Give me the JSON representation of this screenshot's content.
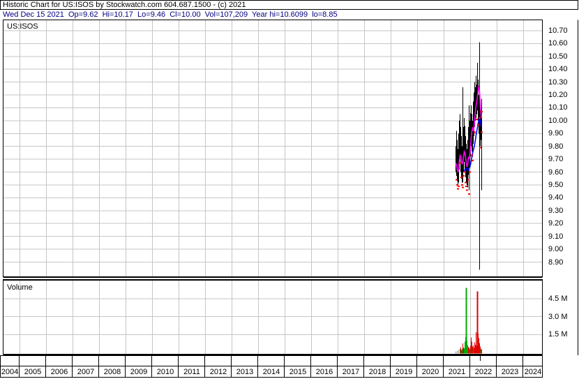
{
  "header": {
    "title": "Historic Chart for US:ISOS by Stockwatch.com 604.687.1500 - (c) 2021",
    "info_line": "Wed Dec 15 2021  Op=9.62  Hi=10.17  Lo=9.46  Cl=10.00  Vol=107,209  Year hi=10.6099  lo=8.85"
  },
  "price_panel": {
    "label": "US:ISOS"
  },
  "volume_panel": {
    "label": "Volume"
  },
  "colors": {
    "background": "#ffffff",
    "border": "#000000",
    "grid": "#c6c6c6",
    "bar": "#000000",
    "ma_fast": "#ff00ff",
    "ma_slow": "#0000ff",
    "close_dot": "#ff0000",
    "vol_up": "#00a800",
    "vol_down": "#e00000",
    "vol_neutral": "#909090",
    "info_text": "#000080"
  },
  "chart_data": [
    {
      "type": "ohlc-bars",
      "title": "US:ISOS",
      "legend_position": "none",
      "grid": true,
      "ylim": [
        8.76,
        10.79
      ],
      "y_ticks": [
        10.7,
        10.6,
        10.5,
        10.4,
        10.3,
        10.2,
        10.1,
        10.0,
        9.9,
        9.8,
        9.7,
        9.6,
        9.5,
        9.4,
        9.3,
        9.2,
        9.1,
        9.0,
        8.9
      ],
      "x_years": [
        "2004",
        "2005",
        "2006",
        "2007",
        "2008",
        "2009",
        "2010",
        "2011",
        "2012",
        "2013",
        "2014",
        "2015",
        "2016",
        "2017",
        "2018",
        "2019",
        "2020",
        "2021",
        "2022",
        "2023",
        "2024"
      ],
      "bars_hi_lo_by_day": [
        [
          0,
          9.8,
          9.6
        ],
        [
          1,
          9.92,
          9.57
        ],
        [
          2,
          9.85,
          9.53
        ],
        [
          3,
          9.78,
          9.5
        ],
        [
          4,
          9.9,
          9.52
        ],
        [
          5,
          10.0,
          9.62
        ],
        [
          6,
          10.05,
          9.7
        ],
        [
          7,
          9.95,
          9.6
        ],
        [
          8,
          9.88,
          9.55
        ],
        [
          9,
          9.8,
          9.52
        ],
        [
          10,
          10.26,
          9.52
        ],
        [
          11,
          9.95,
          9.6
        ],
        [
          12,
          10.02,
          9.68
        ],
        [
          13,
          9.96,
          9.62
        ],
        [
          14,
          9.88,
          9.56
        ],
        [
          15,
          9.82,
          9.52
        ],
        [
          16,
          9.78,
          9.5
        ],
        [
          17,
          9.85,
          9.48
        ],
        [
          18,
          9.95,
          9.58
        ],
        [
          19,
          10.12,
          9.46
        ],
        [
          20,
          10.0,
          9.64
        ],
        [
          21,
          10.06,
          9.72
        ],
        [
          22,
          10.12,
          9.8
        ],
        [
          23,
          10.05,
          9.76
        ],
        [
          24,
          10.0,
          9.72
        ],
        [
          25,
          10.15,
          9.82
        ],
        [
          26,
          10.22,
          9.88
        ],
        [
          27,
          10.3,
          9.95
        ],
        [
          28,
          10.26,
          10.0
        ],
        [
          29,
          10.35,
          10.02
        ],
        [
          30,
          10.28,
          10.05
        ],
        [
          31,
          10.45,
          10.08
        ],
        [
          32,
          10.32,
          10.0
        ],
        [
          33,
          10.2,
          9.9
        ],
        [
          35,
          10.1,
          9.8
        ],
        [
          36,
          10.05,
          9.85
        ],
        [
          37,
          10.17,
          9.46
        ]
      ],
      "year_range_marker": {
        "day": 34,
        "hi": 10.61,
        "lo": 8.84
      },
      "ma_fast": {
        "name": "fast moving average",
        "start_day": 0,
        "values": [
          9.67,
          9.65,
          9.62,
          9.6,
          9.63,
          9.69,
          9.73,
          9.72,
          9.69,
          9.66,
          9.68,
          9.72,
          9.76,
          9.75,
          9.71,
          9.67,
          9.64,
          9.66,
          9.72,
          9.7,
          9.74,
          9.8,
          9.87,
          9.92,
          9.94,
          9.92,
          9.95,
          10.01,
          10.07,
          10.12,
          10.15,
          10.19,
          10.24,
          10.27,
          10.22,
          10.12,
          10.05,
          10.02
        ]
      },
      "ma_slow": {
        "name": "slow moving average",
        "start_day": 11,
        "values": [
          9.6,
          9.61,
          9.62,
          9.63,
          9.63,
          9.62,
          9.61,
          9.62,
          9.63,
          9.64,
          9.66,
          9.69,
          9.72,
          9.75,
          9.77,
          9.79,
          9.82,
          9.85,
          9.89,
          9.92,
          9.95,
          9.98,
          10.01,
          10.02,
          10.0,
          9.97,
          9.95
        ]
      },
      "close_dots_day_price": [
        [
          1,
          9.54
        ],
        [
          2,
          9.5
        ],
        [
          3,
          9.47
        ],
        [
          4,
          9.49
        ],
        [
          6,
          9.67
        ],
        [
          8,
          9.56
        ],
        [
          9,
          9.5
        ],
        [
          10,
          9.48
        ],
        [
          11,
          9.57
        ],
        [
          13,
          9.6
        ],
        [
          14,
          9.52
        ],
        [
          15,
          9.49
        ],
        [
          16,
          9.46
        ],
        [
          18,
          9.54
        ],
        [
          19,
          9.43
        ],
        [
          20,
          9.6
        ],
        [
          23,
          9.73
        ],
        [
          24,
          9.69
        ],
        [
          27,
          9.91
        ],
        [
          30,
          10.01
        ],
        [
          32,
          9.97
        ],
        [
          34,
          10.02
        ],
        [
          35,
          9.79
        ],
        [
          37,
          9.91
        ],
        [
          37,
          10.07
        ]
      ]
    },
    {
      "type": "bar",
      "title": "Volume",
      "y_ticks_labels": [
        "4.5 M",
        "3.0 M",
        "1.5 M"
      ],
      "y_ticks_millions": [
        4.5,
        3.0,
        1.5
      ],
      "bars_day_millions_dir": [
        [
          0,
          0.1,
          "n"
        ],
        [
          2,
          0.15,
          "n"
        ],
        [
          4,
          0.2,
          "n"
        ],
        [
          6,
          0.3,
          "u"
        ],
        [
          7,
          0.45,
          "d"
        ],
        [
          8,
          0.2,
          "d"
        ],
        [
          9,
          0.3,
          "u"
        ],
        [
          10,
          0.75,
          "d"
        ],
        [
          11,
          0.4,
          "d"
        ],
        [
          12,
          0.35,
          "u"
        ],
        [
          13,
          0.9,
          "u"
        ],
        [
          14,
          1.3,
          "u"
        ],
        [
          15,
          5.4,
          "u"
        ],
        [
          16,
          1.0,
          "u"
        ],
        [
          17,
          0.6,
          "u"
        ],
        [
          18,
          0.45,
          "d"
        ],
        [
          19,
          0.4,
          "d"
        ],
        [
          20,
          0.3,
          "u"
        ],
        [
          21,
          0.55,
          "d"
        ],
        [
          22,
          1.25,
          "d"
        ],
        [
          23,
          0.9,
          "d"
        ],
        [
          24,
          0.5,
          "d"
        ],
        [
          25,
          0.6,
          "u"
        ],
        [
          26,
          0.4,
          "d"
        ],
        [
          27,
          0.85,
          "d"
        ],
        [
          28,
          0.65,
          "d"
        ],
        [
          29,
          1.7,
          "d"
        ],
        [
          30,
          0.55,
          "d"
        ],
        [
          31,
          5.1,
          "d"
        ],
        [
          32,
          1.6,
          "d"
        ],
        [
          33,
          1.2,
          "d"
        ],
        [
          34,
          0.8,
          "d"
        ],
        [
          35,
          0.5,
          "d"
        ],
        [
          36,
          0.3,
          "u"
        ],
        [
          37,
          0.25,
          "d"
        ]
      ],
      "current_date_tick_day": 35
    }
  ]
}
